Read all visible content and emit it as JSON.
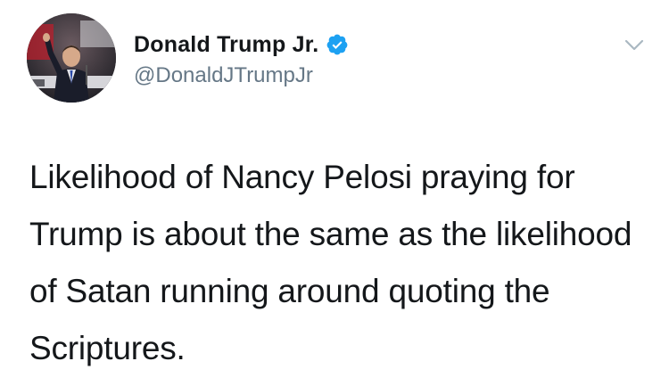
{
  "tweet": {
    "author": {
      "display_name": "Donald Trump Jr.",
      "handle": "@DonaldJTrumpJr",
      "verified": true,
      "avatar_icon": "profile-photo"
    },
    "menu_icon": "chevron-down-icon",
    "text": "Likelihood of Nancy Pelosi praying for Trump is about the same as the likelihood of Satan running around quoting the Scriptures."
  },
  "colors": {
    "verified_blue": "#1da1f2",
    "handle_gray": "#657786",
    "text": "#14171a",
    "caret_gray": "#aab8c2"
  }
}
